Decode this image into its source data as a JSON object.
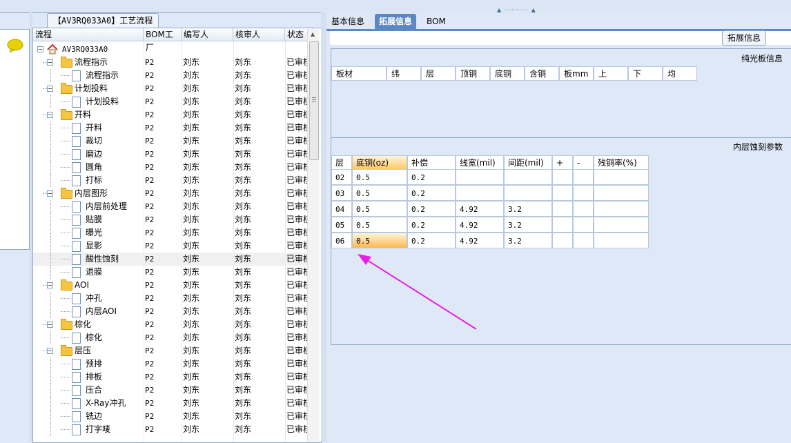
{
  "tree_panel": {
    "title": "【AV3RQ033A0】工艺流程",
    "columns": [
      "流程",
      "BOM工厂",
      "编写人",
      "核审人",
      "状态"
    ],
    "root": "AV3RQ033A0",
    "rows": [
      {
        "level": 1,
        "type": "folder",
        "name": "流程指示",
        "bom": "P2",
        "writer": "刘东",
        "reviewer": "刘东",
        "status": "已审核"
      },
      {
        "level": 2,
        "type": "doc",
        "name": "流程指示",
        "bom": "P2",
        "writer": "刘东",
        "reviewer": "刘东",
        "status": "已审核"
      },
      {
        "level": 1,
        "type": "folder",
        "name": "计划投料",
        "bom": "P2",
        "writer": "刘东",
        "reviewer": "刘东",
        "status": "已审核"
      },
      {
        "level": 2,
        "type": "doc",
        "name": "计划投料",
        "bom": "P2",
        "writer": "刘东",
        "reviewer": "刘东",
        "status": "已审核"
      },
      {
        "level": 1,
        "type": "folder",
        "name": "开料",
        "bom": "P2",
        "writer": "刘东",
        "reviewer": "刘东",
        "status": "已审核"
      },
      {
        "level": 2,
        "type": "doc",
        "name": "开料",
        "bom": "P2",
        "writer": "刘东",
        "reviewer": "刘东",
        "status": "已审核"
      },
      {
        "level": 2,
        "type": "doc",
        "name": "裁切",
        "bom": "P2",
        "writer": "刘东",
        "reviewer": "刘东",
        "status": "已审核"
      },
      {
        "level": 2,
        "type": "doc",
        "name": "磨边",
        "bom": "P2",
        "writer": "刘东",
        "reviewer": "刘东",
        "status": "已审核"
      },
      {
        "level": 2,
        "type": "doc",
        "name": "圆角",
        "bom": "P2",
        "writer": "刘东",
        "reviewer": "刘东",
        "status": "已审核"
      },
      {
        "level": 2,
        "type": "doc",
        "name": "打标",
        "bom": "P2",
        "writer": "刘东",
        "reviewer": "刘东",
        "status": "已审核"
      },
      {
        "level": 1,
        "type": "folder",
        "name": "内层图形",
        "bom": "P2",
        "writer": "刘东",
        "reviewer": "刘东",
        "status": "已审核"
      },
      {
        "level": 2,
        "type": "doc",
        "name": "内层前处理",
        "bom": "P2",
        "writer": "刘东",
        "reviewer": "刘东",
        "status": "已审核"
      },
      {
        "level": 2,
        "type": "doc",
        "name": "贴膜",
        "bom": "P2",
        "writer": "刘东",
        "reviewer": "刘东",
        "status": "已审核"
      },
      {
        "level": 2,
        "type": "doc",
        "name": "曝光",
        "bom": "P2",
        "writer": "刘东",
        "reviewer": "刘东",
        "status": "已审核"
      },
      {
        "level": 2,
        "type": "doc",
        "name": "显影",
        "bom": "P2",
        "writer": "刘东",
        "reviewer": "刘东",
        "status": "已审核"
      },
      {
        "level": 2,
        "type": "doc",
        "name": "酸性蚀刻",
        "bom": "P2",
        "writer": "刘东",
        "reviewer": "刘东",
        "status": "已审核",
        "selected": true
      },
      {
        "level": 2,
        "type": "doc",
        "name": "退膜",
        "bom": "P2",
        "writer": "刘东",
        "reviewer": "刘东",
        "status": "已审核"
      },
      {
        "level": 1,
        "type": "folder",
        "name": "AOI",
        "bom": "P2",
        "writer": "刘东",
        "reviewer": "刘东",
        "status": "已审核"
      },
      {
        "level": 2,
        "type": "doc",
        "name": "冲孔",
        "bom": "P2",
        "writer": "刘东",
        "reviewer": "刘东",
        "status": "已审核"
      },
      {
        "level": 2,
        "type": "doc",
        "name": "内层AOI",
        "bom": "P2",
        "writer": "刘东",
        "reviewer": "刘东",
        "status": "已审核"
      },
      {
        "level": 1,
        "type": "folder",
        "name": "棕化",
        "bom": "P2",
        "writer": "刘东",
        "reviewer": "刘东",
        "status": "已审核"
      },
      {
        "level": 2,
        "type": "doc",
        "name": "棕化",
        "bom": "P2",
        "writer": "刘东",
        "reviewer": "刘东",
        "status": "已审核"
      },
      {
        "level": 1,
        "type": "folder",
        "name": "层压",
        "bom": "P2",
        "writer": "刘东",
        "reviewer": "刘东",
        "status": "已审核"
      },
      {
        "level": 2,
        "type": "doc",
        "name": "预排",
        "bom": "P2",
        "writer": "刘东",
        "reviewer": "刘东",
        "status": "已审核"
      },
      {
        "level": 2,
        "type": "doc",
        "name": "排板",
        "bom": "P2",
        "writer": "刘东",
        "reviewer": "刘东",
        "status": "已审核"
      },
      {
        "level": 2,
        "type": "doc",
        "name": "压合",
        "bom": "P2",
        "writer": "刘东",
        "reviewer": "刘东",
        "status": "已审核"
      },
      {
        "level": 2,
        "type": "doc",
        "name": "X-Ray冲孔",
        "bom": "P2",
        "writer": "刘东",
        "reviewer": "刘东",
        "status": "已审核"
      },
      {
        "level": 2,
        "type": "doc",
        "name": "铣边",
        "bom": "P2",
        "writer": "刘东",
        "reviewer": "刘东",
        "status": "已审核"
      },
      {
        "level": 2,
        "type": "doc",
        "name": "打字唛",
        "bom": "P2",
        "writer": "刘东",
        "reviewer": "刘东",
        "status": "已审核"
      }
    ]
  },
  "tabs": [
    {
      "label": "基本信息",
      "active": false
    },
    {
      "label": "拓展信息",
      "active": true
    },
    {
      "label": "BOM",
      "active": false
    }
  ],
  "extend_button": "拓展信息",
  "light_board": {
    "title": "纯光板信息",
    "columns": [
      "板材",
      "纬",
      "层",
      "顶铜",
      "底铜",
      "含铜",
      "板mm",
      "上",
      "下",
      "均"
    ]
  },
  "inner_etch": {
    "title": "内层蚀刻参数",
    "columns": [
      "层",
      "底铜(oz)",
      "补偿",
      "线宽(mil)",
      "间距(mil)",
      "+",
      "-",
      "残铜率(%)"
    ],
    "rows": [
      [
        "02",
        "0.5",
        "0.2",
        "",
        "",
        "",
        "",
        ""
      ],
      [
        "03",
        "0.5",
        "0.2",
        "",
        "",
        "",
        "",
        ""
      ],
      [
        "04",
        "0.5",
        "0.2",
        "4.92",
        "3.2",
        "",
        "",
        ""
      ],
      [
        "05",
        "0.5",
        "0.2",
        "4.92",
        "3.2",
        "",
        "",
        ""
      ],
      [
        "06",
        "0.5",
        "0.2",
        "4.92",
        "3.2",
        "",
        "",
        ""
      ]
    ]
  },
  "colors": {
    "accent": "#5b88c5",
    "annotation": "#e81ee8",
    "highlight": "#ffc867"
  },
  "icons": {
    "chat": "speech-bubble-icon",
    "root": "home-icon",
    "folder": "folder-icon",
    "doc": "document-icon"
  }
}
